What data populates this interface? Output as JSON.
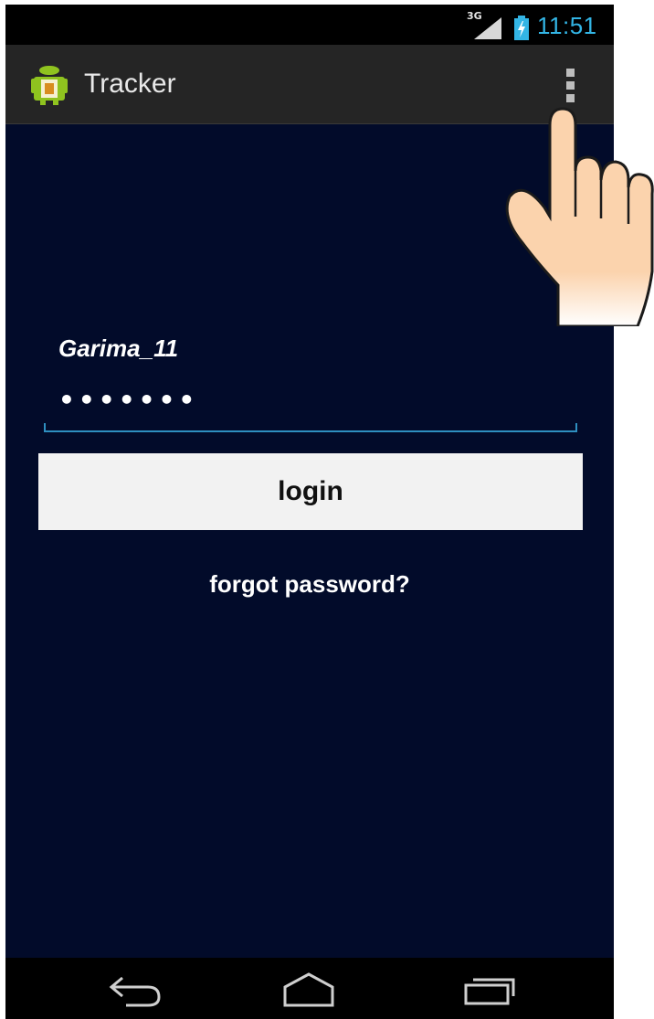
{
  "status_bar": {
    "network": "3G",
    "time": "11:51",
    "icons": [
      "signal-icon",
      "battery-charging-icon"
    ]
  },
  "action_bar": {
    "app_icon": "android-app-icon",
    "title": "Tracker",
    "overflow_icon": "overflow-menu-icon"
  },
  "login_form": {
    "username_value": "Garima_11",
    "password_mask": "•••••••",
    "login_label": "login",
    "forgot_label": "forgot password?"
  },
  "nav_bar": {
    "icons": [
      "back-icon",
      "home-icon",
      "recent-apps-icon"
    ]
  },
  "colors": {
    "accent": "#33b5e5",
    "background": "#020b2a",
    "action_bar": "#252525"
  },
  "overlay": {
    "icon": "tap-hand-icon"
  }
}
